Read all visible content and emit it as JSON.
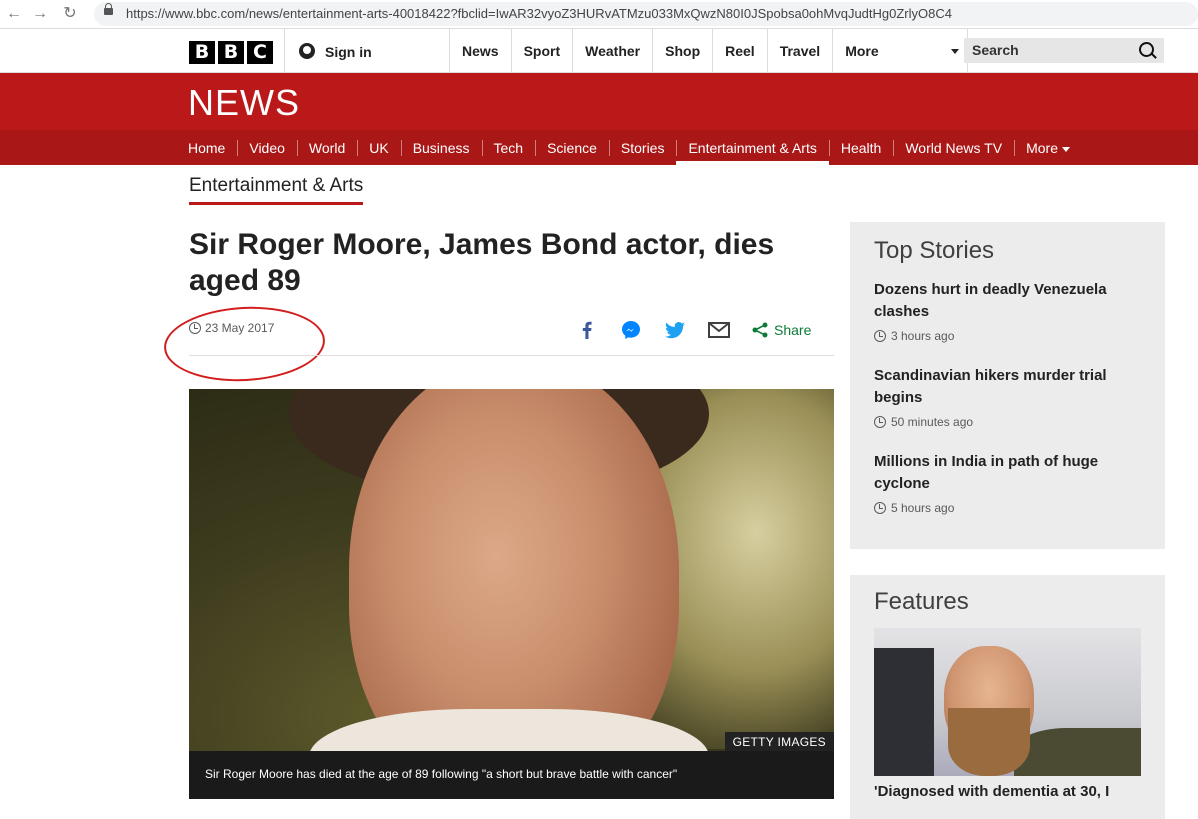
{
  "browser": {
    "url": "https://www.bbc.com/news/entertainment-arts-40018422?fbclid=IwAR32vyoZ3HURvATMzu033MxQwzN80I0JSpobsa0ohMvqJudtHg0ZrlyO8C4"
  },
  "header": {
    "logo_letters": [
      "B",
      "B",
      "C"
    ],
    "sign_in_label": "Sign in",
    "nav": [
      "News",
      "Sport",
      "Weather",
      "Shop",
      "Reel",
      "Travel"
    ],
    "more_label": "More",
    "search_placeholder": "Search"
  },
  "news_band": {
    "logo": "NEWS",
    "subnav": [
      "Home",
      "Video",
      "World",
      "UK",
      "Business",
      "Tech",
      "Science",
      "Stories",
      "Entertainment & Arts",
      "Health",
      "World News TV",
      "More"
    ],
    "active_index": 8
  },
  "article": {
    "section": "Entertainment & Arts",
    "headline": "Sir Roger Moore, James Bond actor, dies aged 89",
    "date": "23 May 2017",
    "share_label": "Share",
    "image_credit": "GETTY IMAGES",
    "caption": "Sir Roger Moore has died at the age of 89 following \"a short but brave battle with cancer\""
  },
  "top_stories": {
    "title": "Top Stories",
    "items": [
      {
        "title": "Dozens hurt in deadly Venezuela clashes",
        "time": "3 hours ago"
      },
      {
        "title": "Scandinavian hikers murder trial begins",
        "time": "50 minutes ago"
      },
      {
        "title": "Millions in India in path of huge cyclone",
        "time": "5 hours ago"
      }
    ]
  },
  "features": {
    "title": "Features",
    "item_title": "'Diagnosed with dementia at 30, I"
  },
  "colors": {
    "bbc_red": "#bb1919",
    "subnav_red": "#a91717",
    "share_green": "#0d7b38",
    "annotation_red": "#d21d1d",
    "panel_gray": "#ececec"
  }
}
